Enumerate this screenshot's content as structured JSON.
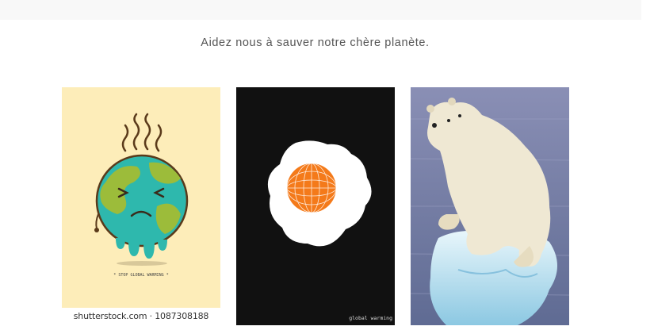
{
  "header": {
    "tagline": "Aidez nous à sauver notre chère planète."
  },
  "gallery": {
    "images": [
      {
        "icon": "melting-earth-illustration",
        "caption_in_image": "* STOP GLOBAL WARMING *",
        "watermark": "shutterstock.com · 1087308188",
        "colors": {
          "background": "#fdedb9",
          "ocean": "#2eb8ad",
          "land": "#9cbc3a"
        }
      },
      {
        "icon": "fried-egg-globe-illustration",
        "caption_in_image": "global warming",
        "colors": {
          "background": "#111111",
          "yolk": "#f47a1a",
          "white": "#ffffff"
        }
      },
      {
        "icon": "polar-bear-on-ice-photo",
        "colors": {
          "water": "#6f7aa0",
          "ice": "#a9d6ea"
        }
      }
    ]
  }
}
